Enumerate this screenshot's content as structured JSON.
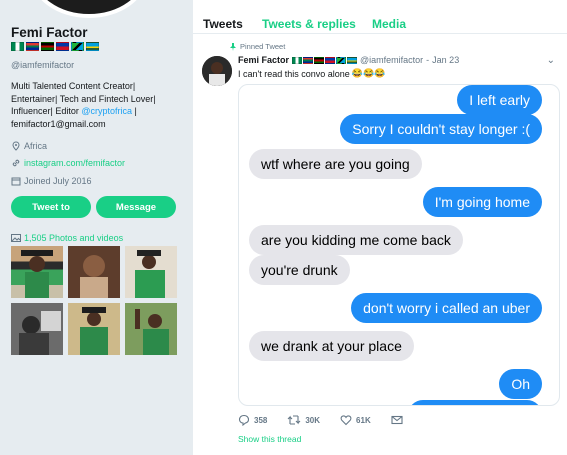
{
  "profile": {
    "name": "Femi Factor",
    "handle": "@iamfemifactor",
    "flags": [
      "#008751",
      "#007a4d",
      "#ce1126",
      "#0038a8",
      "#1eb53a",
      "#00a3dd"
    ],
    "bio_line1": "Multi Talented Content Creator|",
    "bio_line2": "Entertainer| Tech and Fintech Lover|",
    "bio_line3_prefix": "Influencer| Editor ",
    "bio_mention": "@cryptofrica",
    "bio_line3_suffix": " |",
    "bio_email": "femifactor1@gmail.com",
    "location": "Africa",
    "website": "instagram.com/femifactor",
    "joined": "Joined July 2016",
    "tweet_to_label": "Tweet to",
    "message_label": "Message",
    "photos_label": "1,505 Photos and videos"
  },
  "tabs": [
    {
      "label": "Tweets",
      "active": true
    },
    {
      "label": "Tweets & replies",
      "active": false
    },
    {
      "label": "Media",
      "active": false
    }
  ],
  "tweet": {
    "pinned_label": "Pinned Tweet",
    "author": "Femi Factor",
    "handle": "@iamfemifactor",
    "date": "Jan 23",
    "text": "I can't read this convo alone",
    "emoji": "😂😂😂",
    "replies": "358",
    "retweets": "30K",
    "likes": "61K",
    "show_thread": "Show this thread"
  },
  "chat": {
    "messages": [
      {
        "dir": "out",
        "text": "I left early"
      },
      {
        "dir": "out",
        "text": "Sorry I couldn't stay longer :("
      },
      {
        "dir": "in",
        "text": "wtf where are you going"
      },
      {
        "dir": "out",
        "text": "I'm going home"
      },
      {
        "dir": "in",
        "text": "are you kidding me come back"
      },
      {
        "dir": "in",
        "text": "you're drunk"
      },
      {
        "dir": "out",
        "text": "don't worry i called an uber"
      },
      {
        "dir": "in",
        "text": "we drank at your place"
      },
      {
        "dir": "out",
        "text": "Oh"
      }
    ]
  },
  "colors": {
    "accent": "#19cf86",
    "imessage_blue": "#1f8cf5",
    "imessage_gray": "#e5e5ea",
    "link_blue": "#1da1f2"
  }
}
